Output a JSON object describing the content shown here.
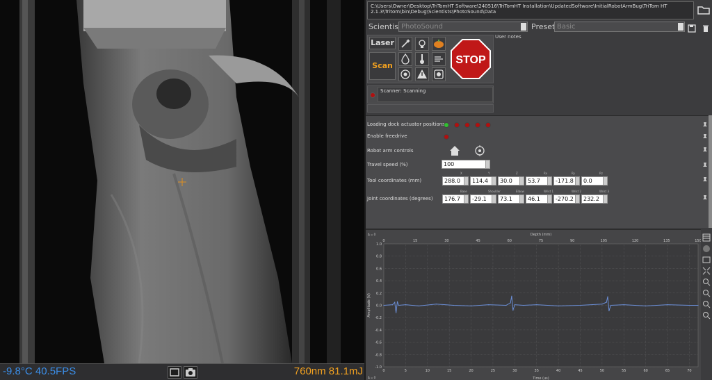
{
  "camera": {
    "temperature_fps": "-9.8°C 40.5FPS",
    "laser_status": "760nm 81.1mJ"
  },
  "path": {
    "text": "C:\\Users\\Owner\\Desktop\\TriTomHT Software\\240516\\TriTomHT Installation\\UpdatedSoftware\\InitialRobotArmBug\\TriTom HT 2.1.3\\Tritom\\bin\\Debug\\Scientists\\PhotoSound\\Data"
  },
  "scientist": {
    "label": "Scientist",
    "value": "PhotoSound"
  },
  "preset": {
    "label": "Preset",
    "value": "Basic"
  },
  "controls": {
    "laser_label": "Laser",
    "scan_label": "Scan",
    "stop_label": "STOP"
  },
  "notes": {
    "label": "User notes"
  },
  "status": {
    "text": "Scanner: Scanning"
  },
  "properties": {
    "loading_dock": "Loading dock actuator positions",
    "freedrive": "Enable freedrive",
    "robot_arm": "Robot arm controls",
    "travel_speed_label": "Travel speed (%)",
    "travel_speed": "100",
    "tool_label": "Tool coordinates (mm)",
    "tool_caps": [
      "X",
      "Y",
      "Z",
      "Rx",
      "Ry",
      "Rz"
    ],
    "tool_values": [
      "288.0",
      "114.4",
      "30.0",
      "53.7",
      "-171.8",
      "0.0"
    ],
    "joint_label": "Joint coordinates (degrees)",
    "joint_caps": [
      "Base",
      "Shoulder",
      "Elbow",
      "Wrist 1",
      "Wrist 2",
      "Wrist 3"
    ],
    "joint_values": [
      "176.7",
      "-29.1",
      "73.1",
      "46.1",
      "-270.2",
      "232.2"
    ]
  },
  "colors": {
    "accent_orange": "#f0a020",
    "temp_blue": "#3b8ee8",
    "signal_blue": "#6b8fd8",
    "led_green": "#30c030",
    "led_red": "#b01010",
    "stop_red": "#c01818"
  },
  "chart_data": {
    "type": "line",
    "title": "",
    "top_xlabel": "Depth (mm)",
    "xlabel": "Time (us)",
    "ylabel": "Amplitude (V)",
    "corner_label_top": "Δ = 0",
    "corner_label_bottom": "Δ = 0",
    "xlim": [
      0,
      72
    ],
    "ylim": [
      -1.0,
      1.0
    ],
    "x_ticks": [
      0,
      5,
      10,
      15,
      20,
      25,
      30,
      35,
      40,
      45,
      50,
      55,
      60,
      65,
      70
    ],
    "top_ticks": [
      0,
      15,
      30,
      45,
      60,
      75,
      90,
      105,
      120,
      135,
      150
    ],
    "y_ticks": [
      "1.0",
      "0.8",
      "0.6",
      "0.4",
      "0.2",
      "0.0",
      "-0.2",
      "-0.4",
      "-0.6",
      "-0.8",
      "-1.0"
    ],
    "grid": true,
    "series": [
      {
        "x": [
          0,
          2,
          2.5,
          2.8,
          3.1,
          3.4,
          5,
          8,
          12,
          16,
          20,
          24,
          28,
          29,
          29.3,
          29.6,
          30,
          32,
          35,
          40,
          45,
          50,
          51,
          51.3,
          51.6,
          52,
          55,
          60,
          65,
          70,
          72
        ],
        "y": [
          0.0,
          0.01,
          0.05,
          -0.12,
          0.06,
          0.0,
          0.01,
          -0.01,
          0.02,
          0.0,
          -0.01,
          0.01,
          0.0,
          0.04,
          0.15,
          -0.08,
          0.01,
          0.0,
          0.01,
          -0.01,
          0.0,
          0.02,
          0.05,
          0.14,
          -0.09,
          0.0,
          0.01,
          -0.01,
          0.01,
          0.0,
          0.0
        ]
      }
    ]
  }
}
